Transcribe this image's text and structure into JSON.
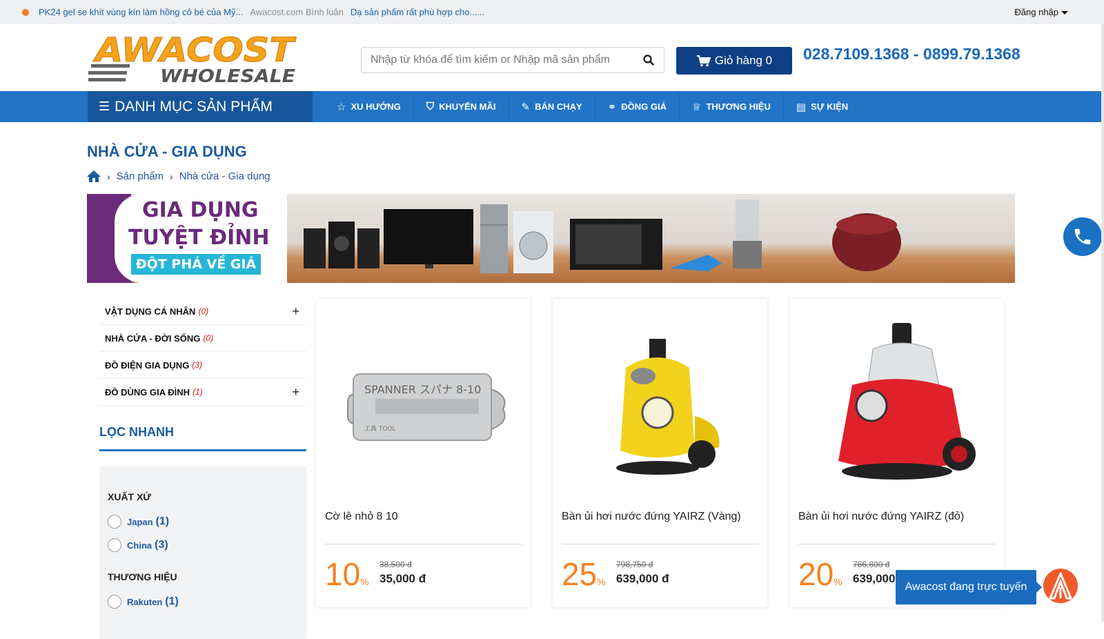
{
  "topbar": {
    "news_1": "PK24 gel se khít vùng kín làm hồng cô bé của Mỹ...",
    "news_2": "Awacost.com Bình luận",
    "news_3": "Dạ sản phẩm rất phù hợp cho......",
    "login_label": "Đăng nhập"
  },
  "header": {
    "logo_top": "AWACOST",
    "logo_bottom": "WHOLESALE",
    "search_placeholder": "Nhập từ khóa để tìm kiếm or Nhập mã sản phẩm",
    "cart_label": "Giỏ hàng 0",
    "hotline": "028.7109.1368 - 0899.79.1368",
    "colors": {
      "brand_blue": "#2174c5",
      "dark_blue": "#0d3f85",
      "accent_orange": "#f58220"
    }
  },
  "nav": {
    "category_button": "DANH MỤC SẢN PHẨM",
    "items": [
      {
        "label": "XU HƯỚNG",
        "icon": "star-icon"
      },
      {
        "label": "KHUYẾN MÃI",
        "icon": "tag-icon"
      },
      {
        "label": "BÁN CHẠY",
        "icon": "hot-tag-icon"
      },
      {
        "label": "ĐỒNG GIÁ",
        "icon": "handshake-icon"
      },
      {
        "label": "THƯƠNG HIỆU",
        "icon": "trophy-icon"
      },
      {
        "label": "SỰ KIỆN",
        "icon": "document-icon"
      }
    ]
  },
  "page": {
    "title": "NHÀ CỬA - GIA DỤNG",
    "breadcrumb": [
      "Sản phẩm",
      "Nhà cửa - Gia dụng"
    ]
  },
  "banner": {
    "line1": "GIA DỤNG",
    "line2": "TUYỆT ĐỈNH",
    "tag": "ĐỘT PHÁ VỀ GIÁ"
  },
  "sidebar": {
    "categories": [
      {
        "label": "VẬT DỤNG CÁ NHÂN",
        "count": "(0)",
        "expandable": "+"
      },
      {
        "label": "NHÀ CỬA - ĐỜI SỐNG",
        "count": "(0)",
        "expandable": ""
      },
      {
        "label": "ĐỒ ĐIỆN GIA DỤNG",
        "count": "(3)",
        "expandable": ""
      },
      {
        "label": "ĐỒ DÙNG GIA ĐÌNH",
        "count": "(1)",
        "expandable": "+"
      }
    ],
    "filter_title": "LỌC NHANH",
    "origin_heading": "XUẤT XỨ",
    "origin_options": [
      {
        "label": "Japan",
        "count": "(1)"
      },
      {
        "label": "China",
        "count": "(3)"
      }
    ],
    "brand_heading": "THƯƠNG HIỆU",
    "brand_options": [
      {
        "label": "Rakuten",
        "count": "(1)"
      }
    ]
  },
  "products": [
    {
      "name": "Cờ lê nhỏ 8 10",
      "discount": "10",
      "old_price": "38,500 đ",
      "new_price": "35,000 đ",
      "image": "spanner-image"
    },
    {
      "name": "Bàn ủi hơi nước đứng YAIRZ (Vàng)",
      "discount": "25",
      "old_price": "798,750 đ",
      "new_price": "639,000 đ",
      "image": "yellow-steamer-image"
    },
    {
      "name": "Bàn ủi hơi nước đứng YAIRZ (đỏ)",
      "discount": "20",
      "old_price": "766,800 đ",
      "new_price": "639,000 đ",
      "image": "red-steamer-image"
    }
  ],
  "widgets": {
    "chat_label": "Awacost đang trực tuyến"
  }
}
